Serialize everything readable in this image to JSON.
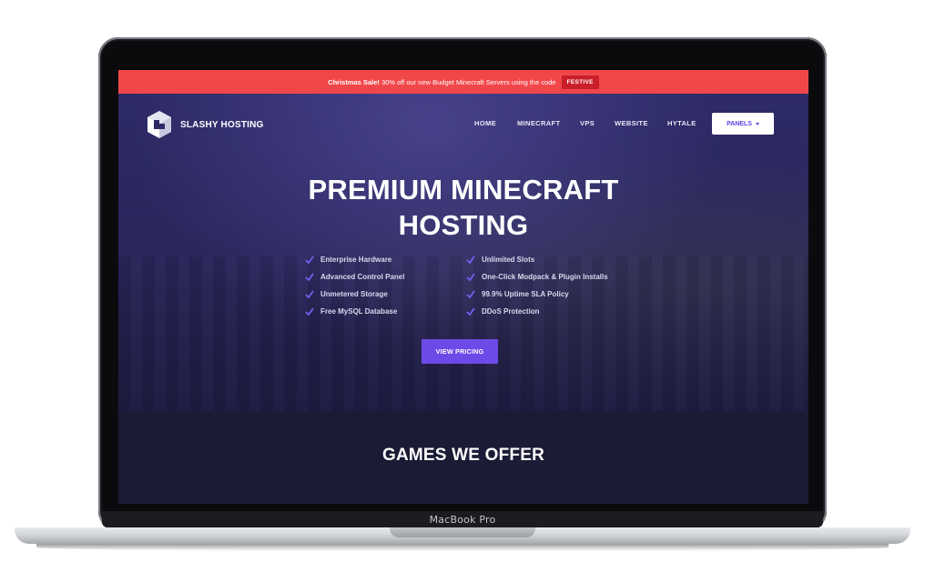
{
  "banner": {
    "sale_bold": "Christmas Sale!",
    "sale_text": "30% off our new Budget Minecraft Servers using the code",
    "code": "FESTIVE",
    "bg_color": "#f2474a",
    "code_color": "#c81f2a"
  },
  "header": {
    "logo_text": "SLASHY HOSTING",
    "logo_icon": "cube-logo-icon",
    "nav": {
      "home": "HOME",
      "minecraft": "MINECRAFT",
      "vps": "VPS",
      "website": "WEBSITE",
      "hytale": "HYTALE"
    },
    "panels_label": "PANELS",
    "panels_icon": "caret-down-icon"
  },
  "hero": {
    "title_line1": "PREMIUM MINECRAFT",
    "title_line2": "HOSTING",
    "features_left": [
      "Enterprise Hardware",
      "Advanced Control Panel",
      "Unmetered Storage",
      "Free MySQL Database"
    ],
    "features_right": [
      "Unlimited Slots",
      "One-Click Modpack & Plugin Installs",
      "99.9% Uptime SLA Policy",
      "DDoS Protection"
    ],
    "feature_icon": "check-icon",
    "cta_label": "VIEW PRICING",
    "accent_color": "#6d4ae8"
  },
  "games": {
    "title": "GAMES WE OFFER"
  },
  "device": {
    "label": "MacBook Pro"
  }
}
